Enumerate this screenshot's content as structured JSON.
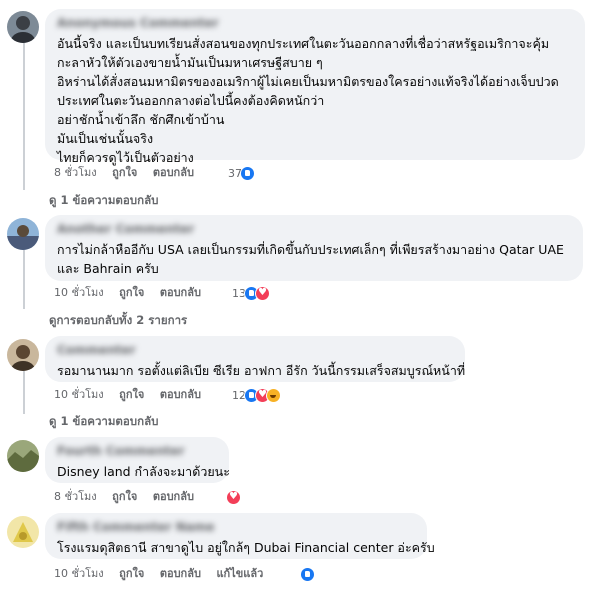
{
  "comments": [
    {
      "author": "Anonymous Commenter",
      "lines": [
        "อันนี้จริง และเป็นบทเรียนสั่งสอนของทุกประเทศในตะวันออกกลางที่เชื่อว่าสหรัฐอเมริกาจะคุ้ม",
        "กะลาหัวให้ตัวเองขายน้ำมันเป็นมหาเศรษฐีสบาย ๆ",
        "อิหร่านได้สั่งสอนมหามิตรของอเมริกาผู้ไม่เคยเป็นมหามิตรของใครอย่างแท้จริงได้อย่างเจ็บปวด",
        "ประเทศในตะวันออกกลางต่อไปนี้คงต้องคิดหนักว่า",
        "อย่าชักน้ำเข้าลึก ชักศึกเข้าบ้าน",
        "มันเป็นเช่นนั้นจริง",
        "ไทยก็ควรดูไว้เป็นตัวอย่าง"
      ],
      "time": "8 ชั่วโมง",
      "like_label": "ถูกใจ",
      "reply_label": "ตอบกลับ",
      "reaction_count": "37",
      "reactions": [
        "like"
      ],
      "replies_link": "ดู 1 ข้อความตอบกลับ"
    },
    {
      "author": "Another Commenter",
      "lines": [
        "การไม่กล้าหืออีกับ USA เลยเป็นกรรมที่เกิดขึ้นกับประเทศเล็กๆ ที่เพียรสร้างมาอย่าง Qatar UAE",
        "และ Bahrain ครับ"
      ],
      "time": "10 ชั่วโมง",
      "like_label": "ถูกใจ",
      "reply_label": "ตอบกลับ",
      "reaction_count": "13",
      "reactions": [
        "like",
        "love"
      ],
      "replies_link": "ดูการตอบกลับทั้ง 2 รายการ"
    },
    {
      "author": "Commenter",
      "lines": [
        "รอมานานมาก รอตั้งแต่ลิเบีย ซีเรีย อาฟกา อีรัก วันนี้กรรมเสร็จสมบูรณ์หน้าที่"
      ],
      "time": "10 ชั่วโมง",
      "like_label": "ถูกใจ",
      "reply_label": "ตอบกลับ",
      "reaction_count": "12",
      "reactions": [
        "like",
        "love",
        "haha"
      ],
      "replies_link": "ดู 1 ข้อความตอบกลับ"
    },
    {
      "author": "Fourth Commenter",
      "lines": [
        "Disney land กำลังจะมาด้วยนะ"
      ],
      "time": "8 ชั่วโมง",
      "like_label": "ถูกใจ",
      "reply_label": "ตอบกลับ",
      "reaction_count": "",
      "reactions": [
        "love"
      ]
    },
    {
      "author": "Fifth Commenter Name",
      "lines": [
        "โรงแรมดุสิตธานี สาขาดูไบ อยู่ใกล้ๆ Dubai Financial center อ่ะครับ"
      ],
      "time": "10 ชั่วโมง",
      "like_label": "ถูกใจ",
      "reply_label": "ตอบกลับ",
      "edited_label": "แก้ไขแล้ว",
      "reaction_count": "",
      "reactions": [
        "like"
      ]
    }
  ],
  "colors": {
    "bubble": "#f0f2f5",
    "meta_text": "#65676b",
    "like": "#1877f2",
    "love": "#f33e58",
    "haha": "#f7b125"
  }
}
